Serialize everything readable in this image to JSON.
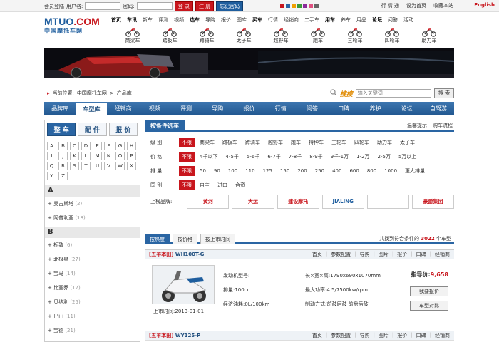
{
  "loginbar": {
    "member_login": "会员登陆",
    "user_label": "用户名:",
    "pass_label": "密码:",
    "login_btn": "登 录",
    "register_btn": "注 册",
    "forgot_btn": "忘记密码"
  },
  "toplinks": {
    "trade": "行 情 通",
    "set_home": "设为首页",
    "favorite": "收藏本站",
    "english": "English"
  },
  "logo": {
    "main": "MTUO",
    "dot": ".COM",
    "sub": "中国摩托车网"
  },
  "mainnav": {
    "row1": [
      {
        "t": "首页",
        "b": true
      },
      {
        "t": "车讯",
        "b": true
      },
      {
        "t": "新车"
      },
      {
        "t": "评测"
      },
      {
        "t": "视频"
      },
      {
        "t": "选车",
        "b": true
      },
      {
        "t": "导购"
      },
      {
        "t": "报价"
      },
      {
        "t": "图库"
      },
      {
        "t": "买车",
        "b": true
      },
      {
        "t": "行情"
      },
      {
        "t": "经销商"
      },
      {
        "t": "二手车"
      },
      {
        "t": "用车",
        "b": true
      },
      {
        "t": "养车"
      },
      {
        "t": "用品"
      },
      {
        "t": "论坛",
        "b": true
      },
      {
        "t": "问答"
      },
      {
        "t": "活动"
      }
    ]
  },
  "cats": [
    "商梁车",
    "踏板车",
    "跨骑车",
    "太子车",
    "越野车",
    "跑车",
    "三轮车",
    "四轮车",
    "助力车"
  ],
  "breadcrumb": {
    "label": "当前位置:",
    "home": "中国摩托车网",
    "sep": ">",
    "current": "产品库"
  },
  "search": {
    "kw": "搜搜",
    "placeholder": "输入关键词",
    "btn": "搜 索"
  },
  "bluenav": [
    "品牌库",
    "车型库",
    "经销商",
    "视频",
    "评测",
    "导购",
    "报价",
    "行情",
    "问答",
    "口碑",
    "养护",
    "论坛",
    "自驾游"
  ],
  "left": {
    "tabs": [
      "整 车",
      "配 件",
      "报 价"
    ],
    "letters": [
      "A",
      "B",
      "C",
      "D",
      "E",
      "F",
      "G",
      "H",
      "I",
      "J",
      "K",
      "L",
      "M",
      "N",
      "O",
      "P",
      "Q",
      "R",
      "S",
      "T",
      "U",
      "V",
      "W",
      "X",
      "Y",
      "Z"
    ],
    "groups": [
      {
        "letter": "A",
        "items": [
          {
            "name": "奥古斯塔",
            "n": "(2)"
          },
          {
            "name": "阿普利亚",
            "n": "(18)"
          }
        ]
      },
      {
        "letter": "B",
        "items": [
          {
            "name": "标致",
            "n": "(6)"
          },
          {
            "name": "北极星",
            "n": "(27)"
          },
          {
            "name": "宝马",
            "n": "(14)"
          },
          {
            "name": "比亚乔",
            "n": "(17)"
          },
          {
            "name": "贝纳利",
            "n": "(25)"
          },
          {
            "name": "巴山",
            "n": "(11)"
          },
          {
            "name": "宝德",
            "n": "(21)"
          }
        ]
      }
    ]
  },
  "filter": {
    "title": "按条件选车",
    "tip1": "温馨提示",
    "tip2": "购车流程",
    "rows": [
      {
        "label": "级  别:",
        "opts": [
          "不限",
          "商梁车",
          "踏板车",
          "跨骑车",
          "越野车",
          "跑车",
          "特种车",
          "三轮车",
          "四轮车",
          "助力车",
          "太子车"
        ]
      },
      {
        "label": "价  格:",
        "opts": [
          "不限",
          "4千以下",
          "4-5千",
          "5-6千",
          "6-7千",
          "7-8千",
          "8-9千",
          "9千-1万",
          "1-2万",
          "2-5万",
          "5万以上"
        ]
      },
      {
        "label": "排  量:",
        "opts": [
          "不限",
          "50",
          "90",
          "100",
          "110",
          "125",
          "150",
          "200",
          "250",
          "400",
          "600",
          "800",
          "1000",
          "更大排量"
        ]
      },
      {
        "label": "国  别:",
        "opts": [
          "不限",
          "自主",
          "进口",
          "合资"
        ]
      }
    ],
    "brand_label": "上榜品牌:",
    "brands": [
      "黄河",
      "大运",
      "建设摩托",
      "JIALING",
      "",
      "豪爵集团"
    ]
  },
  "sort": {
    "tabs": [
      "按热度",
      "按价格",
      "按上市时间"
    ],
    "res_pre": "共找到符合条件的",
    "res_num": "3022",
    "res_post": "个车型"
  },
  "models": [
    {
      "brand": "[五羊本田]",
      "name": "WH100T-G",
      "links": [
        "首页",
        "参数配置",
        "导购",
        "图片",
        "报价",
        "口碑",
        "经销商"
      ],
      "date_label": "上市时间:",
      "date": "2013-01-01",
      "specs": [
        "发动机型号:",
        "长×宽×高:1790x690x1070mm",
        "排量:100cc",
        "最大功率:4.5/7500kw/rpm",
        "经济油耗:0L/100km",
        "制动方式:前鼓后鼓  前盘后鼓"
      ],
      "price_label": "指导价:",
      "price": "9,658",
      "btn1": "我要报价",
      "btn2": "车型对比"
    },
    {
      "brand": "[五羊本田]",
      "name": "WY125-P",
      "links": [
        "首页",
        "参数配置",
        "导购",
        "图片",
        "报价",
        "口碑",
        "经销商"
      ]
    }
  ],
  "colors": {
    "brand_blue": "#1f5e9e",
    "brand_red": "#c8161d"
  }
}
